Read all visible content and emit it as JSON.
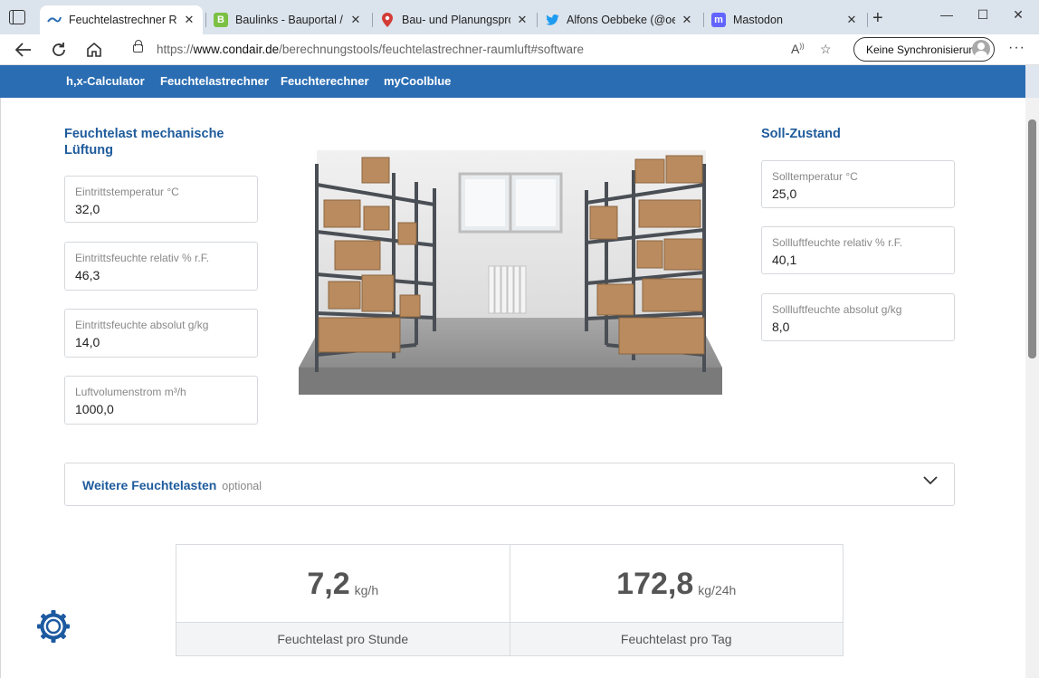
{
  "browser": {
    "tabs": [
      {
        "title": "Feuchtelastrechner Raumluft",
        "active": true,
        "icon": "condair-favicon-icon"
      },
      {
        "title": "Baulinks - Bauportal / Baufachinformationen",
        "active": false,
        "icon": "baulinks-favicon-icon"
      },
      {
        "title": "Bau- und Planungsprojekte",
        "active": false,
        "icon": "map-pin-favicon-icon"
      },
      {
        "title": "Alfons Oebbeke (@oebbeke)",
        "active": false,
        "icon": "twitter-bird-icon"
      },
      {
        "title": "Mastodon",
        "active": false,
        "icon": "mastodon-icon"
      }
    ],
    "url_prefix": "https://",
    "url_domain": "www.condair.de",
    "url_path": "/berechnungstools/feuchtelastrechner-raumluft#software",
    "sync_label": "Keine Synchronisierung"
  },
  "sitenav": {
    "items": [
      "h,x-Calculator",
      "Feuchtelastrechner",
      "Feuchterechner",
      "myCoolblue"
    ]
  },
  "left": {
    "title": "Feuchtelast mechanische Lüftung",
    "fields": [
      {
        "label": "Eintrittstemperatur °C",
        "value": "32,0"
      },
      {
        "label": "Eintrittsfeuchte relativ % r.F.",
        "value": "46,3"
      },
      {
        "label": "Eintrittsfeuchte absolut g/kg",
        "value": "14,0"
      },
      {
        "label": "Luftvolumenstrom m³/h",
        "value": "1000,0"
      }
    ]
  },
  "right": {
    "title": "Soll-Zustand",
    "fields": [
      {
        "label": "Solltemperatur °C",
        "value": "25,0"
      },
      {
        "label": "Sollluftfeuchte relativ % r.F.",
        "value": "40,1"
      },
      {
        "label": "Sollluftfeuchte absolut g/kg",
        "value": "8,0"
      }
    ]
  },
  "accordion": {
    "title": "Weitere Feuchtelasten",
    "optional": "optional"
  },
  "results": [
    {
      "value": "7,2",
      "unit": "kg/h",
      "label": "Feuchtelast pro Stunde"
    },
    {
      "value": "172,8",
      "unit": "kg/24h",
      "label": "Feuchtelast pro Tag"
    }
  ],
  "colors": {
    "brand_blue": "#2a6db3",
    "title_blue": "#1e5b9c",
    "gear_blue": "#1d5aa0"
  }
}
